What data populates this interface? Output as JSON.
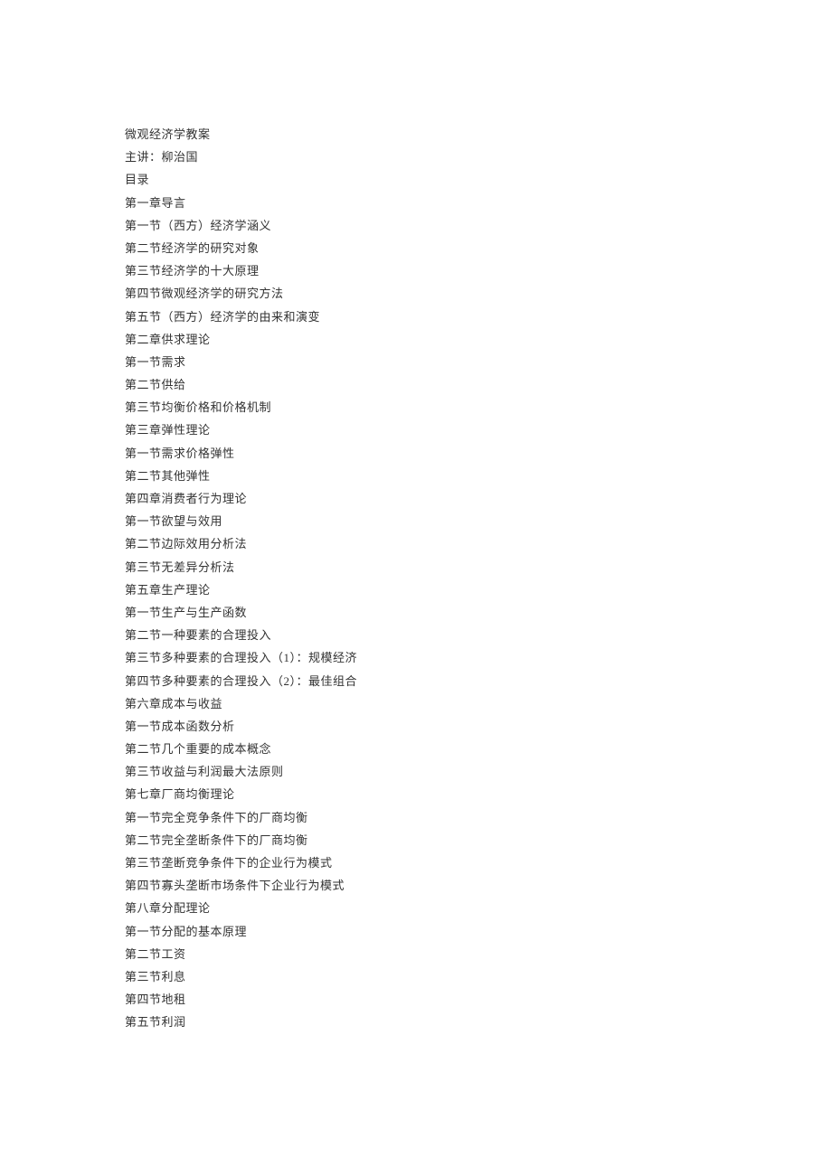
{
  "lines": [
    "微观经济学教案",
    "主讲：柳治国",
    "目录",
    "第一章导言",
    "第一节（西方）经济学涵义",
    "第二节经济学的研究对象",
    "第三节经济学的十大原理",
    "第四节微观经济学的研究方法",
    "第五节（西方）经济学的由来和演变",
    "第二章供求理论",
    "第一节需求",
    "第二节供给",
    "第三节均衡价格和价格机制",
    "第三章弹性理论",
    "第一节需求价格弹性",
    "第二节其他弹性",
    "第四章消费者行为理论",
    "第一节欲望与效用",
    "第二节边际效用分析法",
    "第三节无差异分析法",
    "第五章生产理论",
    "第一节生产与生产函数",
    "第二节一种要素的合理投入",
    "第三节多种要素的合理投入（1）：规模经济",
    "第四节多种要素的合理投入（2）：最佳组合",
    "第六章成本与收益",
    "第一节成本函数分析",
    "第二节几个重要的成本概念",
    "第三节收益与利润最大法原则",
    "第七章厂商均衡理论",
    "第一节完全竞争条件下的厂商均衡",
    "第二节完全垄断条件下的厂商均衡",
    "第三节垄断竞争条件下的企业行为模式",
    "第四节寡头垄断市场条件下企业行为模式",
    "第八章分配理论",
    "第一节分配的基本原理",
    "第二节工资",
    "第三节利息",
    "第四节地租",
    "第五节利润"
  ]
}
